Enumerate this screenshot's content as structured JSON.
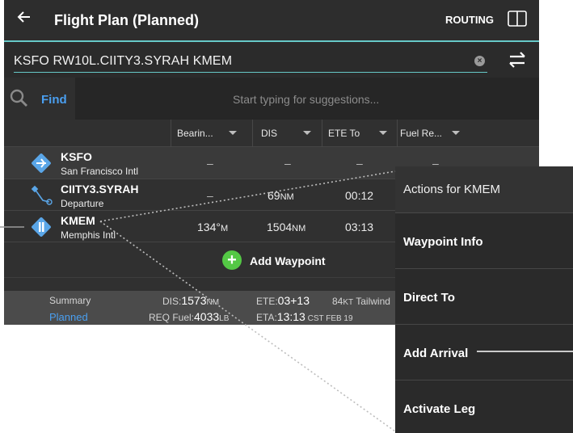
{
  "header": {
    "back_icon": "arrow-left-icon",
    "title": "Flight Plan (Planned)",
    "routing_label": "ROUTING",
    "book_icon": "book-icon"
  },
  "route": {
    "value": "KSFO RW10L.CIITY3.SYRAH KMEM",
    "clear_icon": "clear-circle-icon",
    "swap_icon": "swap-icon"
  },
  "find": {
    "search_icon": "search-icon",
    "label": "Find",
    "placeholder": "Start typing for suggestions..."
  },
  "columns": [
    "Bearin...",
    "DIS",
    "ETE To",
    "Fuel Re..."
  ],
  "waypoints": [
    {
      "id": "KSFO",
      "name": "San Francisco Intl",
      "bearing": "–",
      "dis": "–",
      "ete": "–",
      "fuel": "–",
      "icon": "airport-icon"
    },
    {
      "id": "CIITY3.SYRAH",
      "name": "Departure",
      "bearing": "–",
      "dis": "69",
      "dis_unit": "NM",
      "ete": "00:12",
      "fuel": "",
      "icon": "departure-procedure-icon"
    },
    {
      "id": "KMEM",
      "name": "Memphis Intl",
      "bearing": "134°",
      "bearing_unit": "M",
      "dis": "1504",
      "dis_unit": "NM",
      "ete": "03:13",
      "fuel": "",
      "icon": "airport-icon"
    }
  ],
  "add_waypoint_label": "Add Waypoint",
  "summary": {
    "label": "Summary",
    "status": "Planned",
    "dis_prefix": "DIS:",
    "dis_value": "1573",
    "dis_unit": "NM",
    "ete_prefix": "ETE:",
    "ete_value": "03+13",
    "wind_value": "84",
    "wind_unit": "KT",
    "wind_label": " Tailwind",
    "fuel_prefix": "REQ Fuel:",
    "fuel_value": "4033",
    "fuel_unit": "LB",
    "eta_prefix": "ETA:",
    "eta_value": "13:13",
    "eta_suffix": " CST FEB 19"
  },
  "actions": {
    "title": "Actions for KMEM",
    "items": [
      "Waypoint Info",
      "Direct To",
      "Add Arrival",
      "Activate Leg"
    ]
  },
  "colors": {
    "accent": "#67c9c8",
    "link": "#4a9ff0",
    "add": "#54c845",
    "airport": "#5aa6e8"
  }
}
